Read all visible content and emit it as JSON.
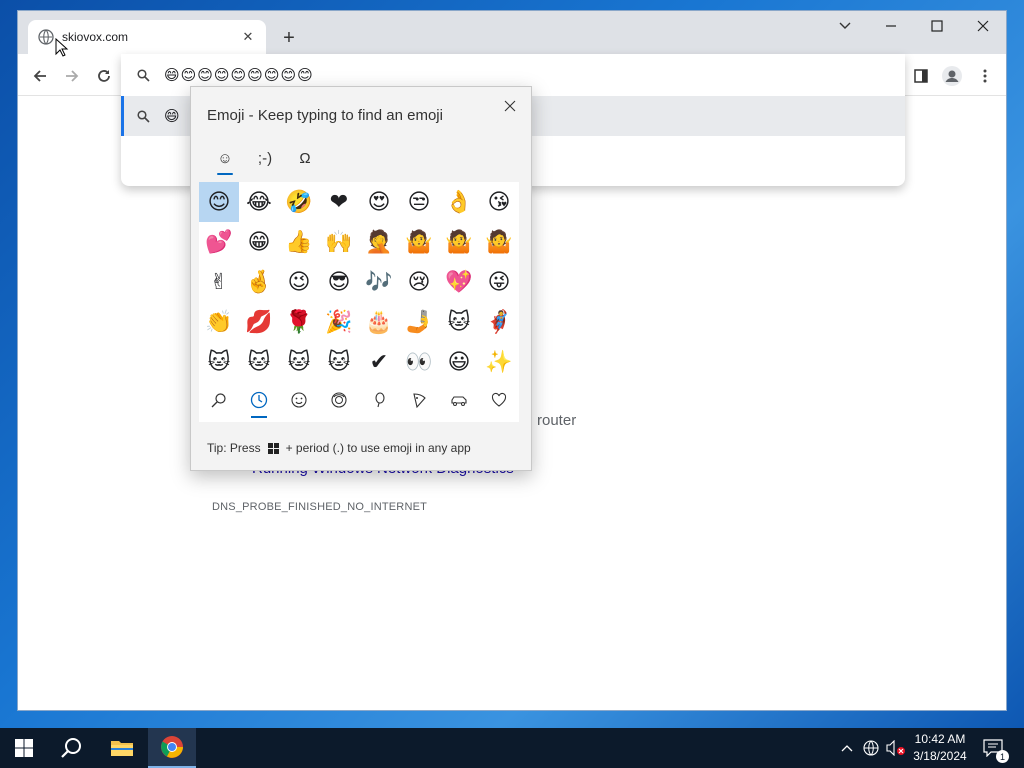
{
  "browser": {
    "tab_title": "skiovox.com",
    "tab_close": "✕",
    "new_tab": "+",
    "minimize": "—",
    "maximize": "☐",
    "close": "✕",
    "dropdown": "⌄"
  },
  "omnibox": {
    "input_text": "😄😊😊😊😊😊😊😊😊",
    "suggestion_text": "😄"
  },
  "page": {
    "router_text": "router",
    "link_text": "Running Windows Network Diagnostics",
    "error_code": "DNS_PROBE_FINISHED_NO_INTERNET"
  },
  "emoji_picker": {
    "title": "Emoji - Keep typing to find an emoji",
    "tabs": [
      {
        "label": "☺",
        "name": "emoji"
      },
      {
        "label": ";-)",
        "name": "kaomoji"
      },
      {
        "label": "Ω",
        "name": "symbols"
      }
    ],
    "emojis": [
      "😊",
      "😂",
      "🤣",
      "❤",
      "😍",
      "😒",
      "👌",
      "😘",
      "💕",
      "😁",
      "👍",
      "🙌",
      "🤦",
      "🤷",
      "🤷",
      "🤷",
      "✌",
      "🤞",
      "😉",
      "😎",
      "🎶",
      "😢",
      "💖",
      "😜",
      "👏",
      "💋",
      "🌹",
      "🎉",
      "🎂",
      "🤳",
      "🐱",
      "🦸",
      "🐱",
      "🐱",
      "🐱",
      "🐱",
      "✔",
      "👀",
      "😃",
      "✨"
    ],
    "categories": [
      "search-icon",
      "recent-icon",
      "smiley-icon",
      "people-icon",
      "celebration-icon",
      "food-icon",
      "travel-icon",
      "heart-icon"
    ],
    "tip_prefix": "Tip: Press",
    "tip_suffix": "+ period (.) to use emoji in any app"
  },
  "taskbar": {
    "time": "10:42 AM",
    "date": "3/18/2024",
    "notification_count": "1"
  },
  "colors": {
    "accent": "#0067c0",
    "selected_cell": "#b7d6f2",
    "link": "#1a0dab"
  }
}
